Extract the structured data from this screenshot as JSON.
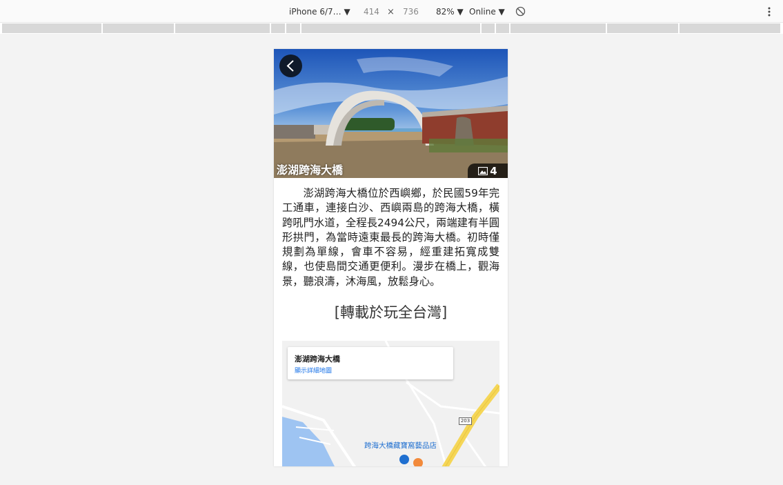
{
  "devtools": {
    "device": "iPhone 6/7… ▼",
    "width": "414",
    "times": "×",
    "height": "736",
    "zoom": "82% ▼",
    "network": "Online ▼"
  },
  "page": {
    "title": "澎湖跨海大橋",
    "photo_count": "4",
    "description": "澎湖跨海大橋位於西嶼鄉，於民國59年完工通車，連接白沙、西嶼兩島的跨海大橋，橫跨吼門水道，全程長2494公尺，兩端建有半圓形拱門，為當時遠東最長的跨海大橋。初時僅規劃為單線，會車不容易，經重建拓寬成雙線，也使島間交通更便利。漫步在橋上，觀海景，聽浪濤，沐海風，放鬆身心。",
    "source": "[轉載於玩全台灣]"
  },
  "map": {
    "place_name": "澎湖跨海大橋",
    "detail_link": "顯示詳細地圖",
    "poi": "跨海大橋藏寶窩藝品店",
    "route_number": "203"
  }
}
